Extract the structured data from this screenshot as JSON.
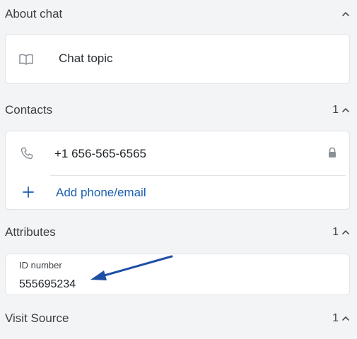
{
  "sections": {
    "about_chat": {
      "title": "About chat"
    },
    "contacts": {
      "title": "Contacts",
      "count": "1"
    },
    "attributes": {
      "title": "Attributes",
      "count": "1"
    },
    "visit_source": {
      "title": "Visit Source",
      "count": "1"
    }
  },
  "about_chat": {
    "topic_label": "Chat topic",
    "icon": "book-icon"
  },
  "contacts": {
    "phone": "+1 656-565-6565",
    "phone_icon": "phone-icon",
    "lock_icon": "lock-icon",
    "add_label": "Add phone/email",
    "add_icon": "plus-icon"
  },
  "attributes": {
    "label": "ID number",
    "value": "555695234"
  },
  "colors": {
    "background": "#f3f4f6",
    "card": "#ffffff",
    "link": "#1a5fb0",
    "annotation_arrow": "#1f4fa3"
  }
}
